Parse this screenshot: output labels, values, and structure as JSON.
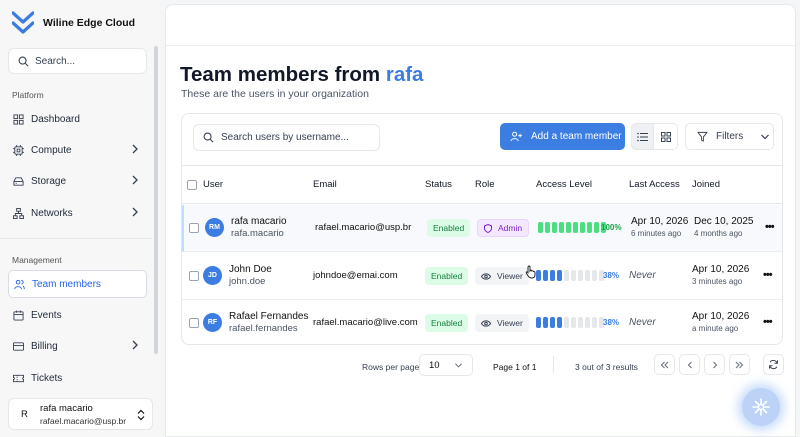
{
  "app": {
    "name": "Wiline Edge Cloud",
    "colors": {
      "accent": "#3b7de0",
      "success": "#16a34a",
      "admin": "#7e22ce"
    }
  },
  "sidebar": {
    "search_placeholder": "Search...",
    "platform_label": "Platform",
    "platform_items": [
      {
        "label": "Dashboard",
        "icon": "dashboard-icon"
      },
      {
        "label": "Compute",
        "icon": "cpu-icon"
      },
      {
        "label": "Storage",
        "icon": "storage-icon"
      },
      {
        "label": "Networks",
        "icon": "network-icon"
      }
    ],
    "management_label": "Management",
    "management_items": [
      {
        "label": "Team members",
        "icon": "users-icon",
        "active": true
      },
      {
        "label": "Events",
        "icon": "calendar-icon"
      },
      {
        "label": "Billing",
        "icon": "credit-card-icon"
      },
      {
        "label": "Tickets",
        "icon": "ticket-icon"
      }
    ],
    "user": {
      "initial": "R",
      "name": "rafa macario",
      "email": "rafael.macario@usp.br"
    }
  },
  "page": {
    "title_prefix": "Team members from ",
    "title_org": "rafa",
    "subtitle": "These are the users in your organization"
  },
  "toolbar": {
    "search_placeholder": "Search users by username...",
    "add_label": "Add a team member",
    "filters_label": "Filters"
  },
  "table": {
    "columns": [
      "User",
      "Email",
      "Status",
      "Role",
      "Access Level",
      "Last Access",
      "Joined"
    ],
    "rows": [
      {
        "initials": "RM",
        "name": "rafa macario",
        "username": "rafa.macario",
        "email": "rafael.macario@usp.br",
        "status": "Enabled",
        "role": "Admin",
        "access_pct": "100%",
        "access_fraction": 1.0,
        "last_access": "Apr 10, 2026",
        "last_access_sub": "6 minutes ago",
        "joined": "Dec 10, 2025",
        "joined_sub": "4 months ago"
      },
      {
        "initials": "JD",
        "name": "John Doe",
        "username": "john.doe",
        "email": "johndoe@emai.com",
        "status": "Enabled",
        "role": "Viewer",
        "access_pct": "38%",
        "access_fraction": 0.38,
        "last_access": "Never",
        "last_access_sub": "",
        "joined": "Apr 10, 2026",
        "joined_sub": "3 minutes ago"
      },
      {
        "initials": "RF",
        "name": "Rafael Fernandes",
        "username": "rafael.fernandes",
        "email": "rafael.macario@live.com",
        "status": "Enabled",
        "role": "Viewer",
        "access_pct": "38%",
        "access_fraction": 0.38,
        "last_access": "Never",
        "last_access_sub": "",
        "joined": "Apr 10, 2026",
        "joined_sub": "a minute ago"
      }
    ]
  },
  "pagination": {
    "rows_per_page_label": "Rows per page",
    "rows_per_page_value": "10",
    "page_label": "Page 1 of 1",
    "results_label": "3 out of 3 results"
  }
}
